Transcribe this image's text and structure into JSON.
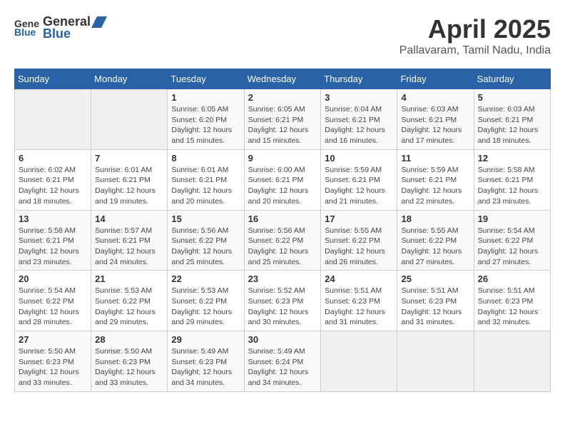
{
  "header": {
    "logo_general": "General",
    "logo_blue": "Blue",
    "month": "April 2025",
    "location": "Pallavaram, Tamil Nadu, India"
  },
  "days_of_week": [
    "Sunday",
    "Monday",
    "Tuesday",
    "Wednesday",
    "Thursday",
    "Friday",
    "Saturday"
  ],
  "weeks": [
    [
      {
        "day": "",
        "sunrise": "",
        "sunset": "",
        "daylight": ""
      },
      {
        "day": "",
        "sunrise": "",
        "sunset": "",
        "daylight": ""
      },
      {
        "day": "1",
        "sunrise": "Sunrise: 6:05 AM",
        "sunset": "Sunset: 6:20 PM",
        "daylight": "Daylight: 12 hours and 15 minutes."
      },
      {
        "day": "2",
        "sunrise": "Sunrise: 6:05 AM",
        "sunset": "Sunset: 6:21 PM",
        "daylight": "Daylight: 12 hours and 15 minutes."
      },
      {
        "day": "3",
        "sunrise": "Sunrise: 6:04 AM",
        "sunset": "Sunset: 6:21 PM",
        "daylight": "Daylight: 12 hours and 16 minutes."
      },
      {
        "day": "4",
        "sunrise": "Sunrise: 6:03 AM",
        "sunset": "Sunset: 6:21 PM",
        "daylight": "Daylight: 12 hours and 17 minutes."
      },
      {
        "day": "5",
        "sunrise": "Sunrise: 6:03 AM",
        "sunset": "Sunset: 6:21 PM",
        "daylight": "Daylight: 12 hours and 18 minutes."
      }
    ],
    [
      {
        "day": "6",
        "sunrise": "Sunrise: 6:02 AM",
        "sunset": "Sunset: 6:21 PM",
        "daylight": "Daylight: 12 hours and 18 minutes."
      },
      {
        "day": "7",
        "sunrise": "Sunrise: 6:01 AM",
        "sunset": "Sunset: 6:21 PM",
        "daylight": "Daylight: 12 hours and 19 minutes."
      },
      {
        "day": "8",
        "sunrise": "Sunrise: 6:01 AM",
        "sunset": "Sunset: 6:21 PM",
        "daylight": "Daylight: 12 hours and 20 minutes."
      },
      {
        "day": "9",
        "sunrise": "Sunrise: 6:00 AM",
        "sunset": "Sunset: 6:21 PM",
        "daylight": "Daylight: 12 hours and 20 minutes."
      },
      {
        "day": "10",
        "sunrise": "Sunrise: 5:59 AM",
        "sunset": "Sunset: 6:21 PM",
        "daylight": "Daylight: 12 hours and 21 minutes."
      },
      {
        "day": "11",
        "sunrise": "Sunrise: 5:59 AM",
        "sunset": "Sunset: 6:21 PM",
        "daylight": "Daylight: 12 hours and 22 minutes."
      },
      {
        "day": "12",
        "sunrise": "Sunrise: 5:58 AM",
        "sunset": "Sunset: 6:21 PM",
        "daylight": "Daylight: 12 hours and 23 minutes."
      }
    ],
    [
      {
        "day": "13",
        "sunrise": "Sunrise: 5:58 AM",
        "sunset": "Sunset: 6:21 PM",
        "daylight": "Daylight: 12 hours and 23 minutes."
      },
      {
        "day": "14",
        "sunrise": "Sunrise: 5:57 AM",
        "sunset": "Sunset: 6:21 PM",
        "daylight": "Daylight: 12 hours and 24 minutes."
      },
      {
        "day": "15",
        "sunrise": "Sunrise: 5:56 AM",
        "sunset": "Sunset: 6:22 PM",
        "daylight": "Daylight: 12 hours and 25 minutes."
      },
      {
        "day": "16",
        "sunrise": "Sunrise: 5:56 AM",
        "sunset": "Sunset: 6:22 PM",
        "daylight": "Daylight: 12 hours and 25 minutes."
      },
      {
        "day": "17",
        "sunrise": "Sunrise: 5:55 AM",
        "sunset": "Sunset: 6:22 PM",
        "daylight": "Daylight: 12 hours and 26 minutes."
      },
      {
        "day": "18",
        "sunrise": "Sunrise: 5:55 AM",
        "sunset": "Sunset: 6:22 PM",
        "daylight": "Daylight: 12 hours and 27 minutes."
      },
      {
        "day": "19",
        "sunrise": "Sunrise: 5:54 AM",
        "sunset": "Sunset: 6:22 PM",
        "daylight": "Daylight: 12 hours and 27 minutes."
      }
    ],
    [
      {
        "day": "20",
        "sunrise": "Sunrise: 5:54 AM",
        "sunset": "Sunset: 6:22 PM",
        "daylight": "Daylight: 12 hours and 28 minutes."
      },
      {
        "day": "21",
        "sunrise": "Sunrise: 5:53 AM",
        "sunset": "Sunset: 6:22 PM",
        "daylight": "Daylight: 12 hours and 29 minutes."
      },
      {
        "day": "22",
        "sunrise": "Sunrise: 5:53 AM",
        "sunset": "Sunset: 6:22 PM",
        "daylight": "Daylight: 12 hours and 29 minutes."
      },
      {
        "day": "23",
        "sunrise": "Sunrise: 5:52 AM",
        "sunset": "Sunset: 6:23 PM",
        "daylight": "Daylight: 12 hours and 30 minutes."
      },
      {
        "day": "24",
        "sunrise": "Sunrise: 5:51 AM",
        "sunset": "Sunset: 6:23 PM",
        "daylight": "Daylight: 12 hours and 31 minutes."
      },
      {
        "day": "25",
        "sunrise": "Sunrise: 5:51 AM",
        "sunset": "Sunset: 6:23 PM",
        "daylight": "Daylight: 12 hours and 31 minutes."
      },
      {
        "day": "26",
        "sunrise": "Sunrise: 5:51 AM",
        "sunset": "Sunset: 6:23 PM",
        "daylight": "Daylight: 12 hours and 32 minutes."
      }
    ],
    [
      {
        "day": "27",
        "sunrise": "Sunrise: 5:50 AM",
        "sunset": "Sunset: 6:23 PM",
        "daylight": "Daylight: 12 hours and 33 minutes."
      },
      {
        "day": "28",
        "sunrise": "Sunrise: 5:50 AM",
        "sunset": "Sunset: 6:23 PM",
        "daylight": "Daylight: 12 hours and 33 minutes."
      },
      {
        "day": "29",
        "sunrise": "Sunrise: 5:49 AM",
        "sunset": "Sunset: 6:23 PM",
        "daylight": "Daylight: 12 hours and 34 minutes."
      },
      {
        "day": "30",
        "sunrise": "Sunrise: 5:49 AM",
        "sunset": "Sunset: 6:24 PM",
        "daylight": "Daylight: 12 hours and 34 minutes."
      },
      {
        "day": "",
        "sunrise": "",
        "sunset": "",
        "daylight": ""
      },
      {
        "day": "",
        "sunrise": "",
        "sunset": "",
        "daylight": ""
      },
      {
        "day": "",
        "sunrise": "",
        "sunset": "",
        "daylight": ""
      }
    ]
  ]
}
